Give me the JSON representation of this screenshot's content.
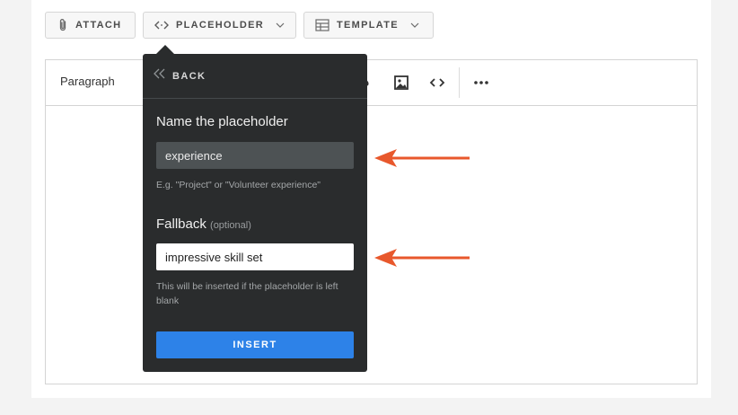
{
  "toolbar": {
    "attach_label": "ATTACH",
    "placeholder_label": "PLACEHOLDER",
    "template_label": "TEMPLATE"
  },
  "editor": {
    "paragraph_label": "Paragraph",
    "icons": [
      "link-icon",
      "image-icon",
      "code-icon",
      "more-icon"
    ]
  },
  "popover": {
    "back_label": "BACK",
    "name_heading": "Name the placeholder",
    "name_value": "experience",
    "name_hint": "E.g. \"Project\" or \"Volunteer experience\"",
    "fallback_heading": "Fallback",
    "fallback_optional": "(optional)",
    "fallback_value": "impressive skill set",
    "fallback_hint": "This will be inserted if the placeholder is left blank",
    "insert_label": "INSERT"
  },
  "colors": {
    "popover_bg": "#2a2c2d",
    "insert_button": "#2d82e8",
    "annotation_arrow": "#e8582c"
  }
}
